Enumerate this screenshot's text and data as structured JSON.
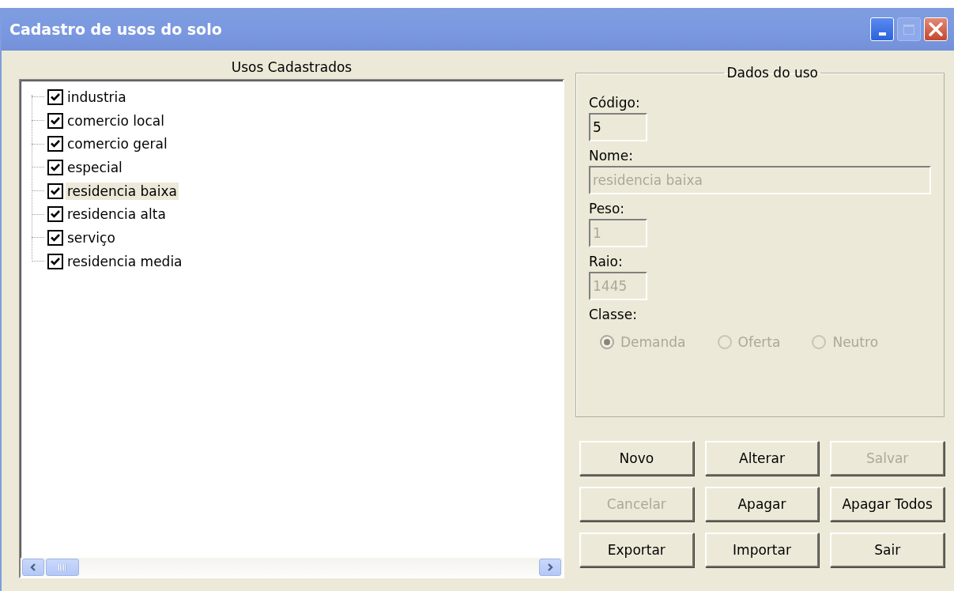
{
  "window": {
    "title": "Cadastro de usos do solo",
    "controls": [
      {
        "kind": "minimize",
        "disabled": false
      },
      {
        "kind": "maximize",
        "disabled": true
      },
      {
        "kind": "close",
        "disabled": false
      }
    ]
  },
  "tree": {
    "heading": "Usos Cadastrados",
    "items": [
      {
        "label": "industria",
        "checked": true,
        "selected": false
      },
      {
        "label": "comercio local",
        "checked": true,
        "selected": false
      },
      {
        "label": "comercio geral",
        "checked": true,
        "selected": false
      },
      {
        "label": "especial",
        "checked": true,
        "selected": false
      },
      {
        "label": "residencia baixa",
        "checked": true,
        "selected": true
      },
      {
        "label": "residencia alta",
        "checked": true,
        "selected": false
      },
      {
        "label": "serviço",
        "checked": true,
        "selected": false
      },
      {
        "label": "residencia media",
        "checked": true,
        "selected": false
      }
    ]
  },
  "group": {
    "title": "Dados do uso",
    "fields": [
      {
        "label": "Código:",
        "value": "5",
        "disabled": false
      },
      {
        "label": "Nome:",
        "value": "residencia baixa",
        "disabled": true
      },
      {
        "label": "Peso:",
        "value": "1",
        "disabled": true
      },
      {
        "label": "Raio:",
        "value": "1445",
        "disabled": true
      }
    ],
    "classe": {
      "label": "Classe:",
      "options": [
        {
          "label": "Demanda",
          "selected": true,
          "disabled": true
        },
        {
          "label": "Oferta",
          "selected": false,
          "disabled": true
        },
        {
          "label": "Neutro",
          "selected": false,
          "disabled": true
        }
      ]
    }
  },
  "buttons": [
    {
      "label": "Novo",
      "disabled": false
    },
    {
      "label": "Alterar",
      "disabled": false
    },
    {
      "label": "Salvar",
      "disabled": true
    },
    {
      "label": "Cancelar",
      "disabled": true
    },
    {
      "label": "Apagar",
      "disabled": false
    },
    {
      "label": "Apagar Todos",
      "disabled": false
    },
    {
      "label": "Exportar",
      "disabled": false
    },
    {
      "label": "Importar",
      "disabled": false
    },
    {
      "label": "Sair",
      "disabled": false
    }
  ]
}
